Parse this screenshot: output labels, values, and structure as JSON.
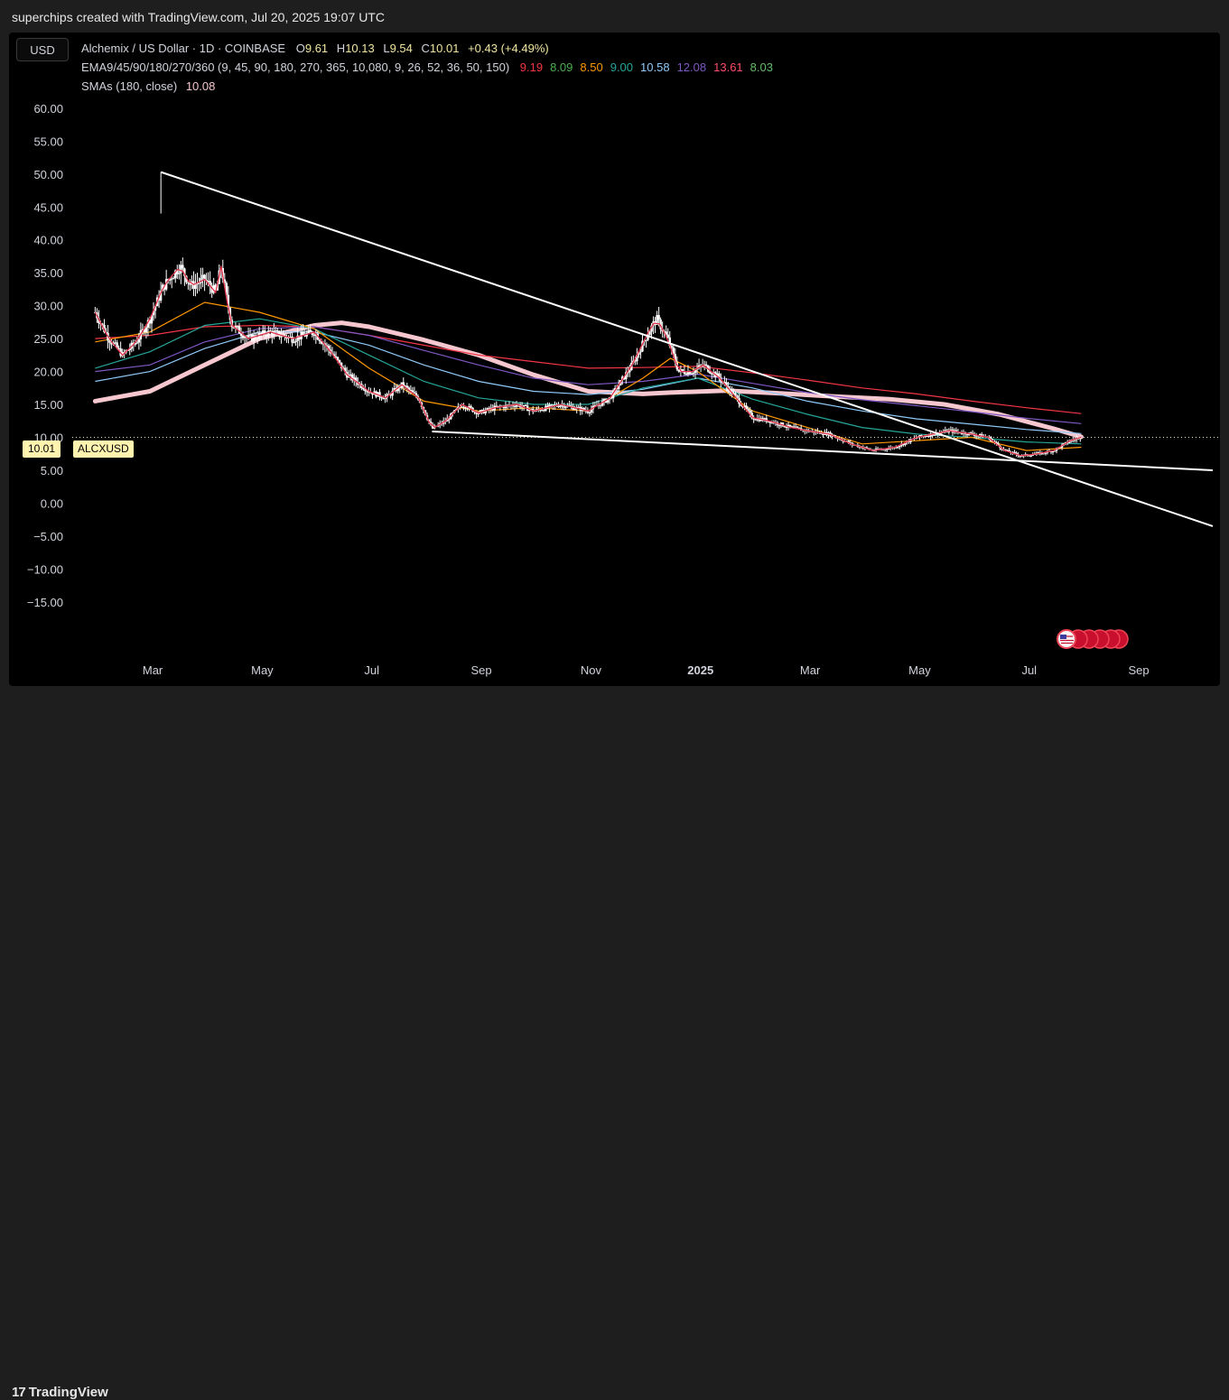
{
  "attribution": "superchips created with TradingView.com, Jul 20, 2025 19:07 UTC",
  "currency_button": "USD",
  "legend": {
    "line1": {
      "pair": "Alchemix / US Dollar · 1D · COINBASE",
      "o_label": "O",
      "o": "9.61",
      "h_label": "H",
      "h": "10.13",
      "l_label": "L",
      "l": "9.54",
      "c_label": "C",
      "c": "10.01",
      "change": "+0.43 (+4.49%)"
    },
    "line2": {
      "label": "EMA9/45/90/180/270/360 (9, 45, 90, 180, 270, 365, 10,080, 9, 26, 52, 36, 50, 150)",
      "values": [
        "9.19",
        "8.09",
        "8.50",
        "9.00",
        "10.58",
        "12.08",
        "13.61",
        "8.03"
      ],
      "colors": [
        "#f23645",
        "#4caf50",
        "#ff9800",
        "#26a69a",
        "#90caf9",
        "#7e57c2",
        "#ff4d6a",
        "#66bb6a"
      ]
    },
    "line3": {
      "label": "SMAs (180, close)",
      "value": "10.08"
    }
  },
  "price_tag": {
    "value": "10.01",
    "symbol": "ALCXUSD"
  },
  "brand": "TradingView",
  "colors": {
    "background": "#000000",
    "candle": "#ffffff",
    "sma_180": "#f6c7cf",
    "price_tag_bg": "#fff3b0",
    "trendline": "#ffffff"
  },
  "chart_data": {
    "type": "line",
    "symbol": "ALCXUSD",
    "ylim": [
      -19,
      63
    ],
    "y_ticks": [
      "60.00",
      "55.00",
      "50.00",
      "45.00",
      "40.00",
      "35.00",
      "30.00",
      "25.00",
      "20.00",
      "15.00",
      "10.00",
      "5.00",
      "0.00",
      "−5.00",
      "−10.00",
      "−15.00"
    ],
    "y_tick_values": [
      60,
      55,
      50,
      45,
      40,
      35,
      30,
      25,
      20,
      15,
      10,
      5,
      0,
      -5,
      -10,
      -15
    ],
    "x_ticks": [
      {
        "label": "Mar",
        "t": 1.05
      },
      {
        "label": "May",
        "t": 3.05
      },
      {
        "label": "Jul",
        "t": 5.05
      },
      {
        "label": "Sep",
        "t": 7.05
      },
      {
        "label": "Nov",
        "t": 9.05
      },
      {
        "label": "2025",
        "t": 11.05,
        "bold": true
      },
      {
        "label": "Mar",
        "t": 13.05
      },
      {
        "label": "May",
        "t": 15.05
      },
      {
        "label": "Jul",
        "t": 17.05
      },
      {
        "label": "Sep",
        "t": 19.05
      }
    ],
    "xlim": [
      -0.55,
      20.4
    ],
    "current_price": 10.01,
    "price_points": [
      [
        0,
        29
      ],
      [
        0.25,
        25
      ],
      [
        0.5,
        22.5
      ],
      [
        0.75,
        24.5
      ],
      [
        1.0,
        28
      ],
      [
        1.25,
        33
      ],
      [
        1.55,
        36
      ],
      [
        1.75,
        33
      ],
      [
        2.0,
        34
      ],
      [
        2.2,
        32
      ],
      [
        2.3,
        36
      ],
      [
        2.4,
        31
      ],
      [
        2.5,
        27
      ],
      [
        2.8,
        25
      ],
      [
        3.2,
        26
      ],
      [
        3.6,
        25
      ],
      [
        4.0,
        26
      ],
      [
        4.3,
        23
      ],
      [
        4.6,
        19.5
      ],
      [
        5.0,
        17
      ],
      [
        5.3,
        16
      ],
      [
        5.6,
        18
      ],
      [
        5.9,
        16
      ],
      [
        6.15,
        11.3
      ],
      [
        6.4,
        12.5
      ],
      [
        6.7,
        15
      ],
      [
        7.0,
        13.7
      ],
      [
        7.3,
        14.5
      ],
      [
        7.7,
        15
      ],
      [
        8.0,
        14
      ],
      [
        8.5,
        15
      ],
      [
        9.0,
        14
      ],
      [
        9.4,
        16
      ],
      [
        9.8,
        21
      ],
      [
        10.1,
        26
      ],
      [
        10.25,
        28
      ],
      [
        10.45,
        25
      ],
      [
        10.65,
        20
      ],
      [
        10.9,
        20
      ],
      [
        11.1,
        21
      ],
      [
        11.4,
        19
      ],
      [
        11.7,
        16
      ],
      [
        12.0,
        13
      ],
      [
        12.3,
        12.5
      ],
      [
        12.7,
        11.5
      ],
      [
        13.0,
        11
      ],
      [
        13.4,
        10.5
      ],
      [
        13.8,
        9
      ],
      [
        14.2,
        8
      ],
      [
        14.6,
        8.5
      ],
      [
        15.0,
        10
      ],
      [
        15.3,
        10.5
      ],
      [
        15.6,
        11
      ],
      [
        16.0,
        10.5
      ],
      [
        16.3,
        10
      ],
      [
        16.6,
        8
      ],
      [
        16.9,
        7.2
      ],
      [
        17.2,
        7.5
      ],
      [
        17.5,
        8
      ],
      [
        17.8,
        9.5
      ],
      [
        18.0,
        10.01
      ]
    ],
    "sma_180_points": [
      [
        0,
        15.5
      ],
      [
        1.0,
        17
      ],
      [
        2.0,
        21
      ],
      [
        3.0,
        25
      ],
      [
        4.0,
        27
      ],
      [
        4.5,
        27.4
      ],
      [
        5.0,
        26.8
      ],
      [
        6.0,
        24.8
      ],
      [
        7.0,
        22.5
      ],
      [
        8.0,
        19.5
      ],
      [
        9.0,
        17
      ],
      [
        10.0,
        16.6
      ],
      [
        10.5,
        16.8
      ],
      [
        11.5,
        17.1
      ],
      [
        12.5,
        16.7
      ],
      [
        13.5,
        16.2
      ],
      [
        14.5,
        15.8
      ],
      [
        15.5,
        15
      ],
      [
        16.5,
        13.5
      ],
      [
        17.5,
        11.3
      ],
      [
        18.0,
        10.08
      ]
    ],
    "ema_lines": [
      {
        "color": "#f23645",
        "points": [
          [
            0,
            25
          ],
          [
            1,
            25.5
          ],
          [
            2,
            26.8
          ],
          [
            3,
            27
          ],
          [
            4,
            26.8
          ],
          [
            5,
            25.5
          ],
          [
            6,
            24
          ],
          [
            7,
            22.5
          ],
          [
            8,
            21.5
          ],
          [
            9,
            20.5
          ],
          [
            10,
            20.6
          ],
          [
            11,
            20.8
          ],
          [
            12,
            19.8
          ],
          [
            13,
            18.7
          ],
          [
            14,
            17.5
          ],
          [
            15,
            16.6
          ],
          [
            16,
            15.5
          ],
          [
            17,
            14.5
          ],
          [
            18,
            13.61
          ]
        ]
      },
      {
        "color": "#7e57c2",
        "points": [
          [
            0,
            20
          ],
          [
            1,
            21
          ],
          [
            2,
            24.5
          ],
          [
            3,
            26.5
          ],
          [
            4,
            26.8
          ],
          [
            5,
            25.5
          ],
          [
            6,
            23.2
          ],
          [
            7,
            21
          ],
          [
            8,
            19
          ],
          [
            9,
            18
          ],
          [
            10,
            18.5
          ],
          [
            11,
            19.6
          ],
          [
            12,
            18.2
          ],
          [
            13,
            16.8
          ],
          [
            14,
            15.7
          ],
          [
            15,
            14.8
          ],
          [
            16,
            13.9
          ],
          [
            17,
            12.9
          ],
          [
            18,
            12.08
          ]
        ]
      },
      {
        "color": "#90caf9",
        "points": [
          [
            0,
            18.5
          ],
          [
            1,
            20
          ],
          [
            2,
            23.5
          ],
          [
            3,
            26
          ],
          [
            4,
            26
          ],
          [
            5,
            24
          ],
          [
            6,
            21
          ],
          [
            7,
            18.5
          ],
          [
            8,
            17
          ],
          [
            9,
            16.5
          ],
          [
            10,
            17.3
          ],
          [
            11,
            19
          ],
          [
            12,
            17.5
          ],
          [
            13,
            15.5
          ],
          [
            14,
            14
          ],
          [
            15,
            12.8
          ],
          [
            16,
            12
          ],
          [
            17,
            11.2
          ],
          [
            18,
            10.58
          ]
        ]
      },
      {
        "color": "#26a69a",
        "points": [
          [
            0,
            20.5
          ],
          [
            1,
            23
          ],
          [
            2,
            27
          ],
          [
            3,
            28
          ],
          [
            4,
            26.5
          ],
          [
            5,
            22.5
          ],
          [
            6,
            18.5
          ],
          [
            7,
            16
          ],
          [
            8,
            15
          ],
          [
            9,
            15
          ],
          [
            10,
            17.5
          ],
          [
            11,
            19
          ],
          [
            12,
            15.8
          ],
          [
            13,
            13.5
          ],
          [
            14,
            11.5
          ],
          [
            15,
            10.5
          ],
          [
            16,
            10
          ],
          [
            17,
            9.3
          ],
          [
            18,
            9.0
          ]
        ]
      },
      {
        "color": "#ff9800",
        "points": [
          [
            0,
            24.5
          ],
          [
            1,
            26
          ],
          [
            2,
            30.5
          ],
          [
            3,
            29
          ],
          [
            4,
            26.5
          ],
          [
            5,
            20.5
          ],
          [
            6,
            15.5
          ],
          [
            7,
            14
          ],
          [
            8,
            14.5
          ],
          [
            9,
            14
          ],
          [
            10,
            19
          ],
          [
            10.5,
            22
          ],
          [
            11,
            20
          ],
          [
            12,
            14
          ],
          [
            13,
            11.5
          ],
          [
            14,
            9
          ],
          [
            15,
            9.5
          ],
          [
            16,
            10
          ],
          [
            17,
            8
          ],
          [
            18,
            8.5
          ]
        ]
      }
    ],
    "trendlines": [
      {
        "from": [
          1.2,
          50.3
        ],
        "to": [
          20.4,
          -3.5
        ]
      },
      {
        "from": [
          6.15,
          10.9
        ],
        "to": [
          20.4,
          5.0
        ]
      }
    ]
  }
}
